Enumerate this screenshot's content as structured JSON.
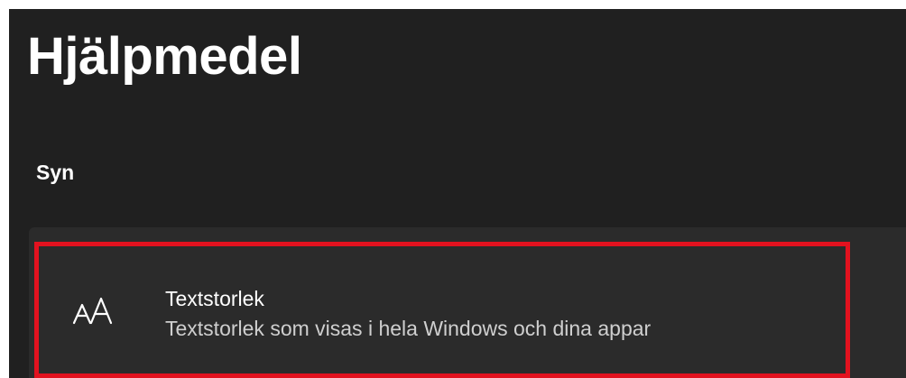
{
  "header": {
    "title": "Hjälpmedel"
  },
  "section": {
    "title": "Syn"
  },
  "settings": [
    {
      "icon": "text-size-icon",
      "title": "Textstorlek",
      "description": "Textstorlek som visas i hela Windows och dina appar",
      "highlight_color": "#e2121f"
    }
  ],
  "colors": {
    "window_background": "#202020",
    "card_background": "#2b2b2b",
    "primary_text": "#ffffff",
    "secondary_text": "#cfcfcf"
  }
}
